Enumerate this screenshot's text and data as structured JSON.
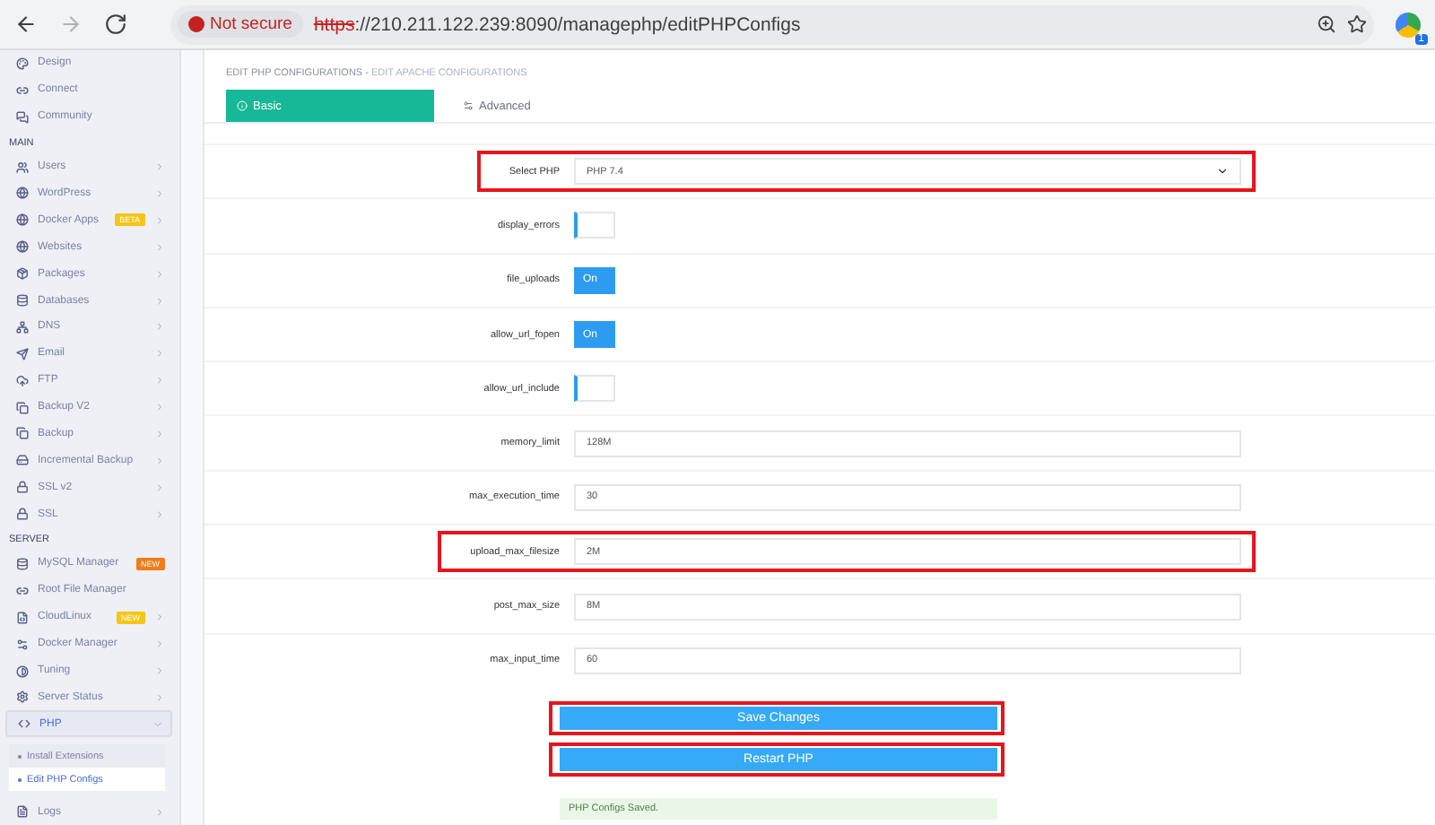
{
  "browser": {
    "nav": [
      {
        "kind": "back",
        "disabled": false
      },
      {
        "kind": "forward",
        "disabled": true
      },
      {
        "kind": "reload",
        "disabled": false
      }
    ],
    "security": "Not secure",
    "url_scheme": "https",
    "url_rest": "://210.211.122.239:8090/managephp/editPHPConfigs",
    "extension_badge": "1"
  },
  "sidebar": {
    "sections": [
      {
        "items": [
          {
            "label": "Design"
          },
          {
            "label": "Connect"
          },
          {
            "label": "Community"
          }
        ]
      },
      {
        "heading": "MAIN",
        "items": [
          {
            "label": "Users",
            "chevron": true
          },
          {
            "label": "WordPress",
            "chevron": true
          },
          {
            "label": "Docker Apps",
            "chevron": true,
            "badge": {
              "text": "BETA",
              "color": "#f5c518"
            }
          },
          {
            "label": "Websites",
            "chevron": true
          },
          {
            "label": "Packages",
            "chevron": true
          },
          {
            "label": "Databases",
            "chevron": true
          },
          {
            "label": "DNS",
            "chevron": true
          },
          {
            "label": "Email",
            "chevron": true
          },
          {
            "label": "FTP",
            "chevron": true
          },
          {
            "label": "Backup V2",
            "chevron": true
          },
          {
            "label": "Backup",
            "chevron": true
          },
          {
            "label": "Incremental Backup",
            "chevron": true
          },
          {
            "label": "SSL v2",
            "chevron": true
          },
          {
            "label": "SSL",
            "chevron": true
          }
        ]
      },
      {
        "heading": "SERVER",
        "items": [
          {
            "label": "MySQL Manager",
            "chevron": false,
            "badge": {
              "text": "NEW",
              "color": "#f07c1a"
            }
          },
          {
            "label": "Root File Manager",
            "chevron": false
          },
          {
            "label": "CloudLinux",
            "chevron": true,
            "badge": {
              "text": "NEW",
              "color": "#f5c518"
            }
          },
          {
            "label": "Docker Manager",
            "chevron": true
          },
          {
            "label": "Tuning",
            "chevron": true
          },
          {
            "label": "Server Status",
            "chevron": true
          },
          {
            "label": "PHP",
            "chevron": true,
            "expanded": true,
            "children": [
              {
                "label": "Install Extensions",
                "selected": false
              },
              {
                "label": "Edit PHP Configs",
                "selected": true
              }
            ]
          },
          {
            "label": "Logs",
            "chevron": true
          }
        ]
      }
    ]
  },
  "breadcrumb": {
    "current": "EDIT PHP CONFIGURATIONS",
    "separator": " - ",
    "link": "EDIT APACHE CONFIGURATIONS"
  },
  "tabs": [
    {
      "label": "Basic",
      "selected": true
    },
    {
      "label": "Advanced",
      "selected": false
    }
  ],
  "fields": [
    {
      "kind": "select",
      "label": "Select PHP",
      "value": "PHP 7.4",
      "highlighted": true
    },
    {
      "kind": "toggle",
      "label": "display_errors",
      "on": false,
      "highlighted": false
    },
    {
      "kind": "toggle",
      "label": "file_uploads",
      "on": true,
      "text": "On",
      "highlighted": false
    },
    {
      "kind": "toggle",
      "label": "allow_url_fopen",
      "on": true,
      "text": "On",
      "highlighted": false
    },
    {
      "kind": "toggle",
      "label": "allow_url_include",
      "on": false,
      "highlighted": false
    },
    {
      "kind": "text",
      "label": "memory_limit",
      "value": "128M",
      "highlighted": false
    },
    {
      "kind": "text",
      "label": "max_execution_time",
      "value": "30",
      "highlighted": false
    },
    {
      "kind": "text",
      "label": "upload_max_filesize",
      "value": "2M",
      "highlighted": true
    },
    {
      "kind": "text",
      "label": "post_max_size",
      "value": "8M",
      "highlighted": false
    },
    {
      "kind": "text",
      "label": "max_input_time",
      "value": "60",
      "highlighted": false
    }
  ],
  "buttons": [
    {
      "label": "Save Changes",
      "highlighted": true
    },
    {
      "label": "Restart PHP",
      "highlighted": true
    }
  ],
  "message": "PHP Configs Saved."
}
